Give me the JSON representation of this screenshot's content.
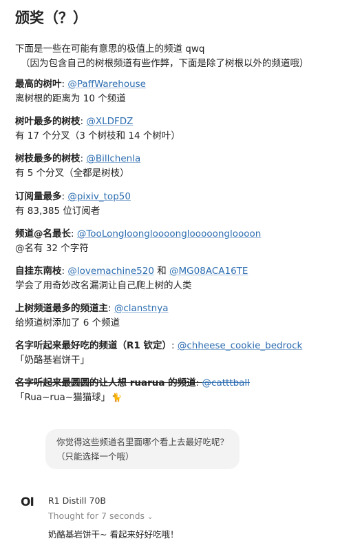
{
  "title": "颁奖（？）",
  "intro": {
    "line1": "下面是一些在可能有意思的极值上的频道 qwq",
    "line2": "（因为包含自己的树根频道有些作弊，下面是除了树根以外的频道哦）"
  },
  "awards": [
    {
      "label": "最高的树叶",
      "sep": ": ",
      "link": "@PaffWarehouse",
      "desc": "离树根的距离为 10 个频道"
    },
    {
      "label": "树叶最多的树枝",
      "sep": ": ",
      "link": "@XLDFDZ",
      "desc": "有 17 个分叉（3 个树枝和 14 个树叶）"
    },
    {
      "label": "树枝最多的树枝",
      "sep": ": ",
      "link": "@Billchenla",
      "desc": "有 5 个分叉（全都是树枝）"
    },
    {
      "label": "订阅量最多",
      "sep": ": ",
      "link": "@pixiv_top50",
      "desc": "有 83,385 位订阅者"
    },
    {
      "label": "频道@名最长",
      "sep": ": ",
      "link": "@TooLongloongloooonglooooongloooon",
      "desc": "@名有 32 个字符"
    },
    {
      "label": "自挂东南枝",
      "sep": ": ",
      "link": "@lovemachine520",
      "joiner": " 和 ",
      "link2": "@MG08ACA16TE",
      "desc": "学会了用奇妙改名漏洞让自己爬上树的人类"
    },
    {
      "label": "上树频道最多的频道主",
      "sep": ": ",
      "link": "@clanstnya",
      "desc": "给频道树添加了 6 个频道"
    },
    {
      "label": "名字听起来最好吃的频道",
      "sub": "（R1 钦定）",
      "sep": ": ",
      "link": "@chheese_cookie_bedrock",
      "desc": "「奶酪基岩饼干」"
    },
    {
      "label": "名字听起来最圆圆的让人想 ruarua 的频道",
      "sep": ": ",
      "link": "@catttball",
      "desc": "「Rua~rua~猫猫球」",
      "emoji": "🐈"
    }
  ],
  "chat": {
    "question": "你觉得这些频道名里面哪个看上去最好吃呢？（只能选择一个哦）",
    "model_logo": "OI",
    "model_name": "R1 Distill 70B",
    "thought": "Thought for 7 seconds",
    "answer": "奶酪基岩饼干~ 看起来好好吃哦！"
  },
  "colors": {
    "link": "#2b6cb0",
    "bubble": "#f3f3f3",
    "muted": "#888888"
  },
  "icons": {
    "thought_toggle": "chevron-down-icon",
    "emoji": "cat-icon"
  }
}
